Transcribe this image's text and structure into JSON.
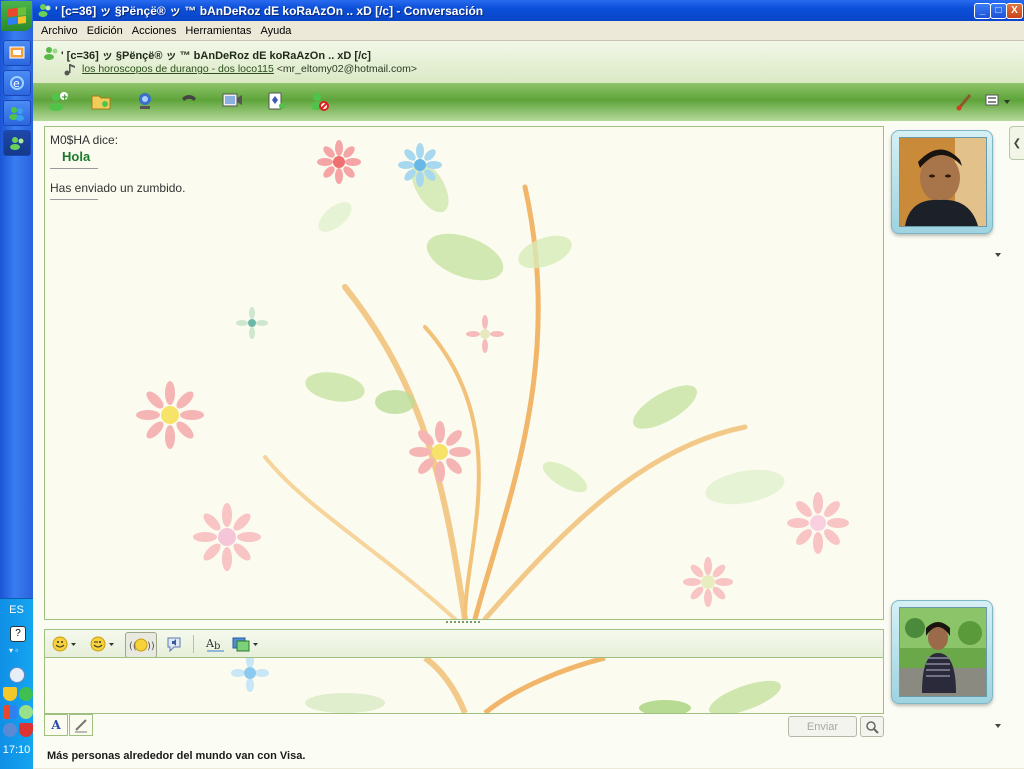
{
  "taskbar": {
    "language": "ES",
    "clock": "17:10"
  },
  "window": {
    "title": "' [c=36]  ッ §Pënçë® ッ ™ bAnDeRoz dE koRaAzOn .. xD [/c] - Conversación",
    "controls": {
      "minimize": "_",
      "maximize": "□",
      "close": "X"
    }
  },
  "menu": {
    "items": [
      "Archivo",
      "Edición",
      "Acciones",
      "Herramientas",
      "Ayuda"
    ]
  },
  "contact": {
    "name": "' [c=36]  ッ §Pënçë® ッ ™ bAnDeRoz dE koRaAzOn .. xD [/c]",
    "personal_message": "los horoscopos de durango - dos loco115",
    "email": "<mr_eltomy02@hotmail.com>"
  },
  "toolbar": {
    "icons": [
      "invite-contact-icon",
      "send-files-icon",
      "video-call-icon",
      "voice-call-icon",
      "activities-icon",
      "games-icon",
      "block-icon",
      "paint-brush-icon",
      "display-options-icon"
    ]
  },
  "conversation": {
    "messages": [
      {
        "sender": "M0$HA dice:",
        "text": "Hola"
      }
    ],
    "system_message": "Has enviado un zumbido."
  },
  "compose": {
    "tools": [
      "emoticon-icon",
      "wink-icon",
      "nudge-icon",
      "voice-clip-icon",
      "spellcheck-icon",
      "background-icon"
    ],
    "send_label": "Enviar"
  },
  "status": {
    "ad_text": "Más personas alrededor del mundo van con Visa."
  },
  "colors": {
    "accent_green": "#5ea43a",
    "title_blue": "#0b4fd8",
    "message_green": "#1a7a2a"
  }
}
